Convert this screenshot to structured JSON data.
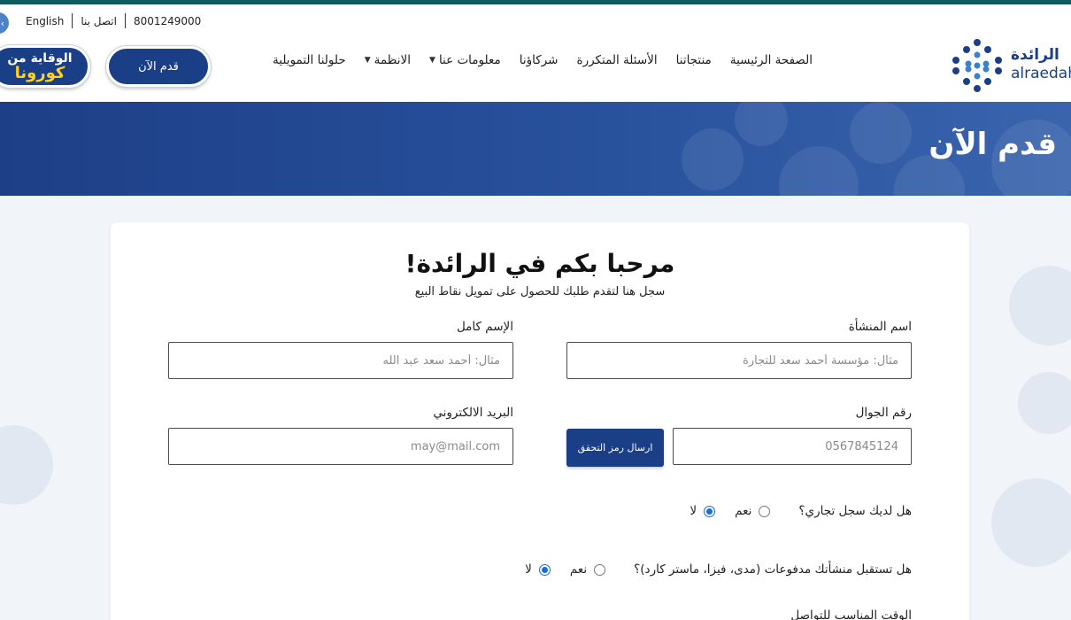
{
  "utility_bar": {
    "language": "English",
    "contact": "اتصل بنا",
    "phone": "8001249000"
  },
  "header": {
    "logo_ar": "الرائدة",
    "logo_en": "alraedah",
    "nav": [
      {
        "label": "الصفحة الرئيسية",
        "dropdown": false
      },
      {
        "label": "منتجاتنا",
        "dropdown": false
      },
      {
        "label": "الأسئلة المتكررة",
        "dropdown": false
      },
      {
        "label": "شركاؤنا",
        "dropdown": false
      },
      {
        "label": "معلومات عنا",
        "dropdown": true
      },
      {
        "label": "الانظمة",
        "dropdown": true
      },
      {
        "label": "حلولنا التمويلية",
        "dropdown": false
      }
    ],
    "apply_button": "قدم الآن",
    "corona_line1": "الوقاية من",
    "corona_line2": "كورونا"
  },
  "banner": {
    "title": "قدم الآن"
  },
  "form": {
    "title": "مرحبا بكم في الرائدة!",
    "subtitle": "سجل هنا لتقدم طلبك للحصول على تمويل نقاط البيع",
    "establishment_name": {
      "label": "اسم المنشأة",
      "placeholder": "مثال: مؤسسة أحمد سعد للتجارة",
      "value": ""
    },
    "full_name": {
      "label": "الإسم كامل",
      "placeholder": "مثال: أحمد سعد عبد الله",
      "value": ""
    },
    "mobile": {
      "label": "رقم الجوال",
      "placeholder": "0567845124",
      "value": ""
    },
    "email": {
      "label": "البريد الالكتروني",
      "placeholder": "may@mail.com",
      "value": ""
    },
    "verify_button": "ارسال رمز التحقق",
    "q_commercial_register": {
      "question": "هل لديك سجل تجاري؟",
      "yes": "نعم",
      "no": "لا",
      "selected": "no"
    },
    "q_card_payments": {
      "question": "هل تستقبل منشأتك مدفوعات (مدى، فيزا، ماستر كارد)؟",
      "yes": "نعم",
      "no": "لا",
      "selected": "no"
    },
    "preferred_time_label": "الوقت المناسب للتواصل"
  },
  "colors": {
    "brand_primary": "#1b3f86",
    "top_strip": "#0f5a5e",
    "corona_accent": "#ffd21e",
    "radio_selected": "#1a6ae0"
  }
}
